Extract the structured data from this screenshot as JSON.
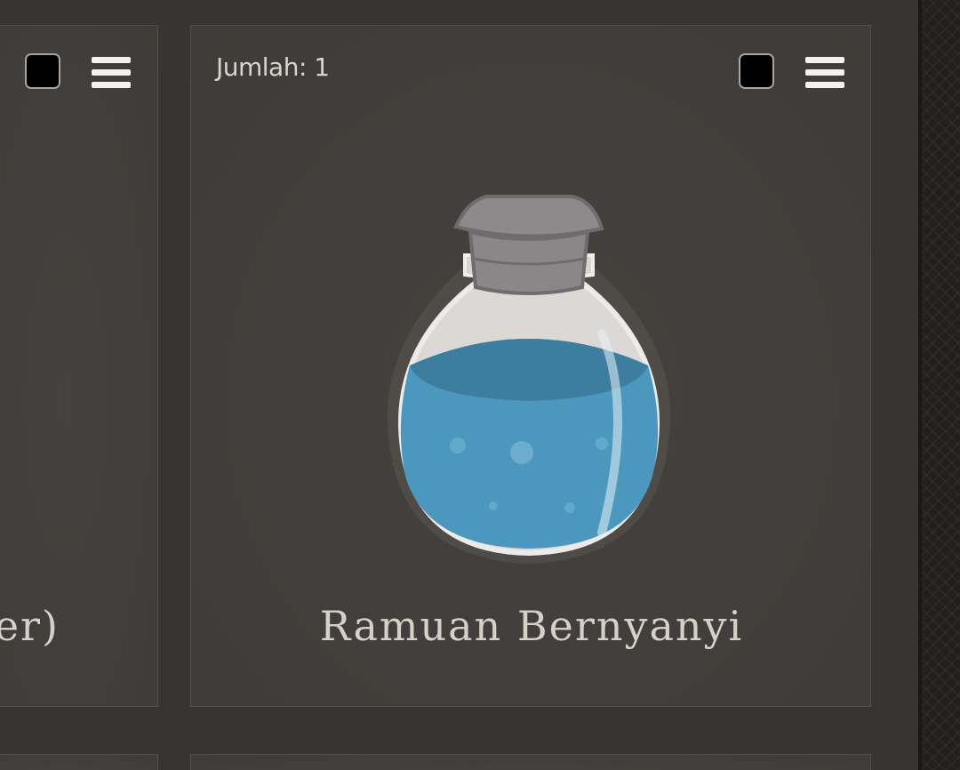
{
  "cards": [
    {
      "title_fragment": "er)"
    },
    {
      "quantity_label": "Jumlah: 1",
      "title": "Ramuan Bernyanyi",
      "icon": "blue-potion-bottle"
    }
  ],
  "colors": {
    "background": "#383431",
    "card": "#423e3b",
    "text": "#d6d0c6",
    "potion_liquid": "#4b97bd",
    "checkbox": "#000000"
  }
}
